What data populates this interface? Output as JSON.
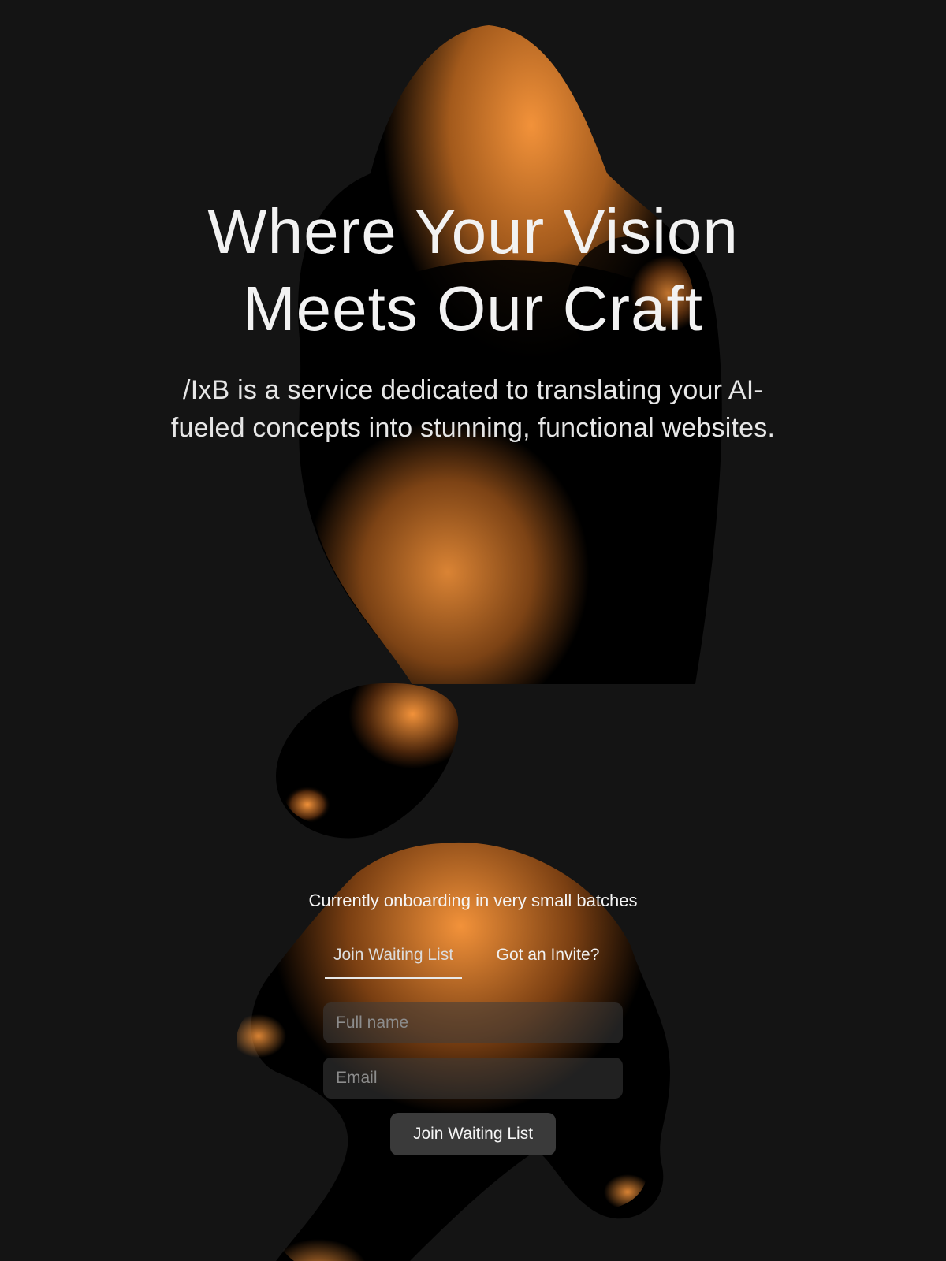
{
  "hero": {
    "title_line1": "Where Your Vision",
    "title_line2": "Meets Our Craft",
    "subtitle": "/IxB is a service dedicated to translating your AI-fueled concepts into stunning, functional websites."
  },
  "waitlist": {
    "note": "Currently onboarding in very small batches",
    "tabs": [
      {
        "label": "Join Waiting List",
        "active": true
      },
      {
        "label": "Got an Invite?",
        "active": false
      }
    ],
    "full_name_placeholder": "Full name",
    "email_placeholder": "Email",
    "submit_label": "Join Waiting List"
  },
  "colors": {
    "background": "#141414",
    "accent": "#f2923a",
    "button": "#3a3a3a"
  }
}
